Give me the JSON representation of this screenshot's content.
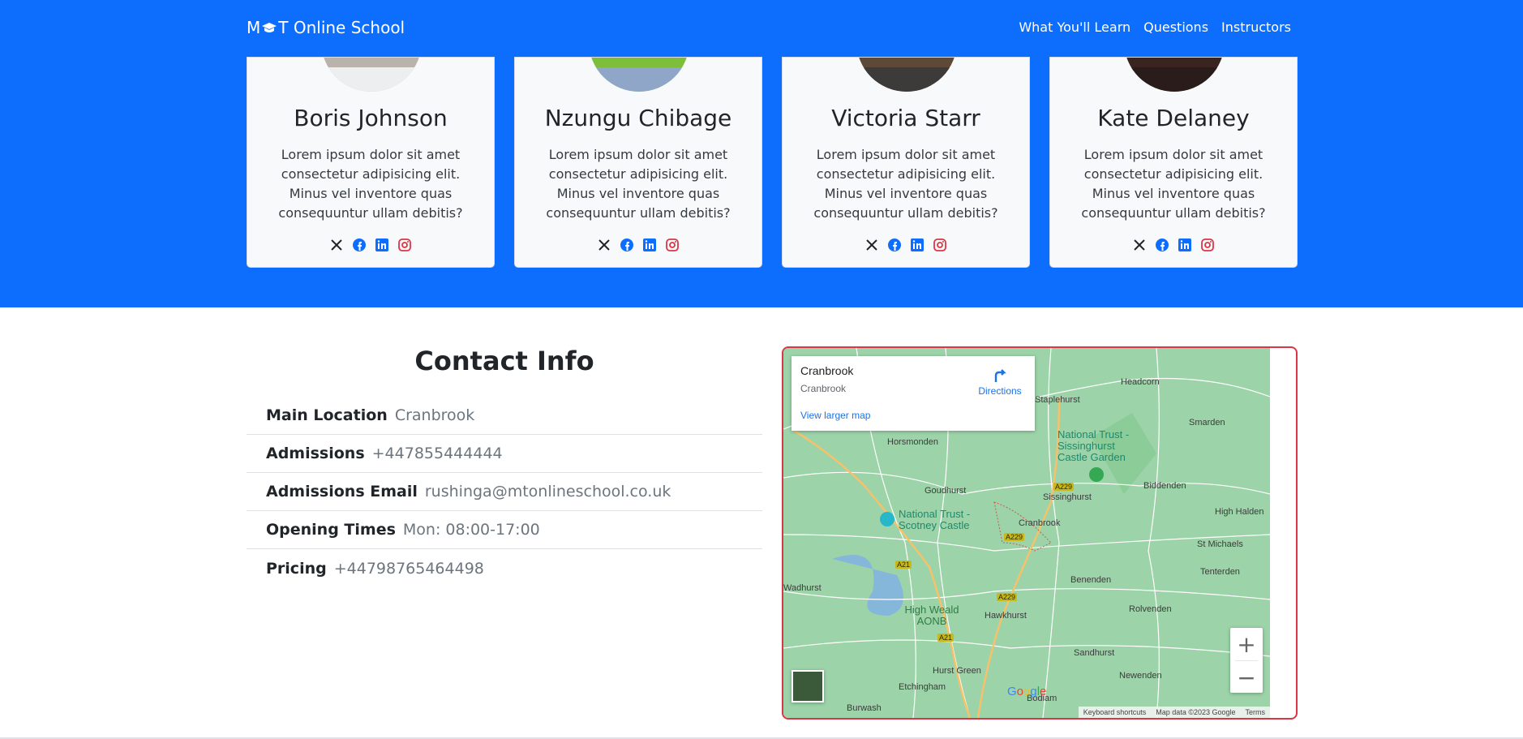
{
  "navbar": {
    "brand": "M",
    "brand_suffix": "T Online School",
    "links": [
      "What You'll Learn",
      "Questions",
      "Instructors"
    ]
  },
  "instructors": [
    {
      "name": "Boris Johnson",
      "bio": "Lorem ipsum dolor sit amet consectetur adipisicing elit. Minus vel inventore quas consequuntur ullam debitis?"
    },
    {
      "name": "Nzungu Chibage",
      "bio": "Lorem ipsum dolor sit amet consectetur adipisicing elit. Minus vel inventore quas consequuntur ullam debitis?"
    },
    {
      "name": "Victoria Starr",
      "bio": "Lorem ipsum dolor sit amet consectetur adipisicing elit. Minus vel inventore quas consequuntur ullam debitis?"
    },
    {
      "name": "Kate Delaney",
      "bio": "Lorem ipsum dolor sit amet consectetur adipisicing elit. Minus vel inventore quas consequuntur ullam debitis?"
    }
  ],
  "social_icons": [
    "x-icon",
    "facebook-icon",
    "linkedin-icon",
    "instagram-icon"
  ],
  "contact": {
    "title": "Contact Info",
    "rows": [
      {
        "label": "Main Location",
        "value": "Cranbrook"
      },
      {
        "label": "Admissions",
        "value": "+447855444444"
      },
      {
        "label": "Admissions Email",
        "value": "rushinga@mtonlineschool.co.uk"
      },
      {
        "label": "Opening Times",
        "value": "Mon: 08:00-17:00"
      },
      {
        "label": "Pricing",
        "value": "+44798765464498"
      }
    ]
  },
  "map": {
    "card_title": "Cranbrook",
    "card_subtitle": "Cranbrook",
    "directions": "Directions",
    "larger_map": "View larger map",
    "places": [
      "Headcorn",
      "Staplehurst",
      "Smarden",
      "Horsmonden",
      "Goudhurst",
      "Sissinghurst",
      "Biddenden",
      "High Halden",
      "Cranbrook",
      "St Michaels",
      "Tenterden",
      "Benenden",
      "Wadhurst",
      "Hawkhurst",
      "Rolvenden",
      "Sandhurst",
      "Newenden",
      "Hurst Green",
      "Etchingham",
      "Bodiam",
      "Burwash"
    ],
    "pois": [
      "National Trust - Sissinghurst Castle Garden",
      "National Trust - Scotney Castle"
    ],
    "aonb": "High Weald AONB",
    "roads": [
      "A229",
      "A229",
      "A229",
      "A21",
      "A21"
    ],
    "attribution": [
      "Keyboard shortcuts",
      "Map data ©2023 Google",
      "Terms"
    ],
    "logo": "Google"
  },
  "colors": {
    "primary": "#0d6efd",
    "accent_border": "#dc3545"
  }
}
